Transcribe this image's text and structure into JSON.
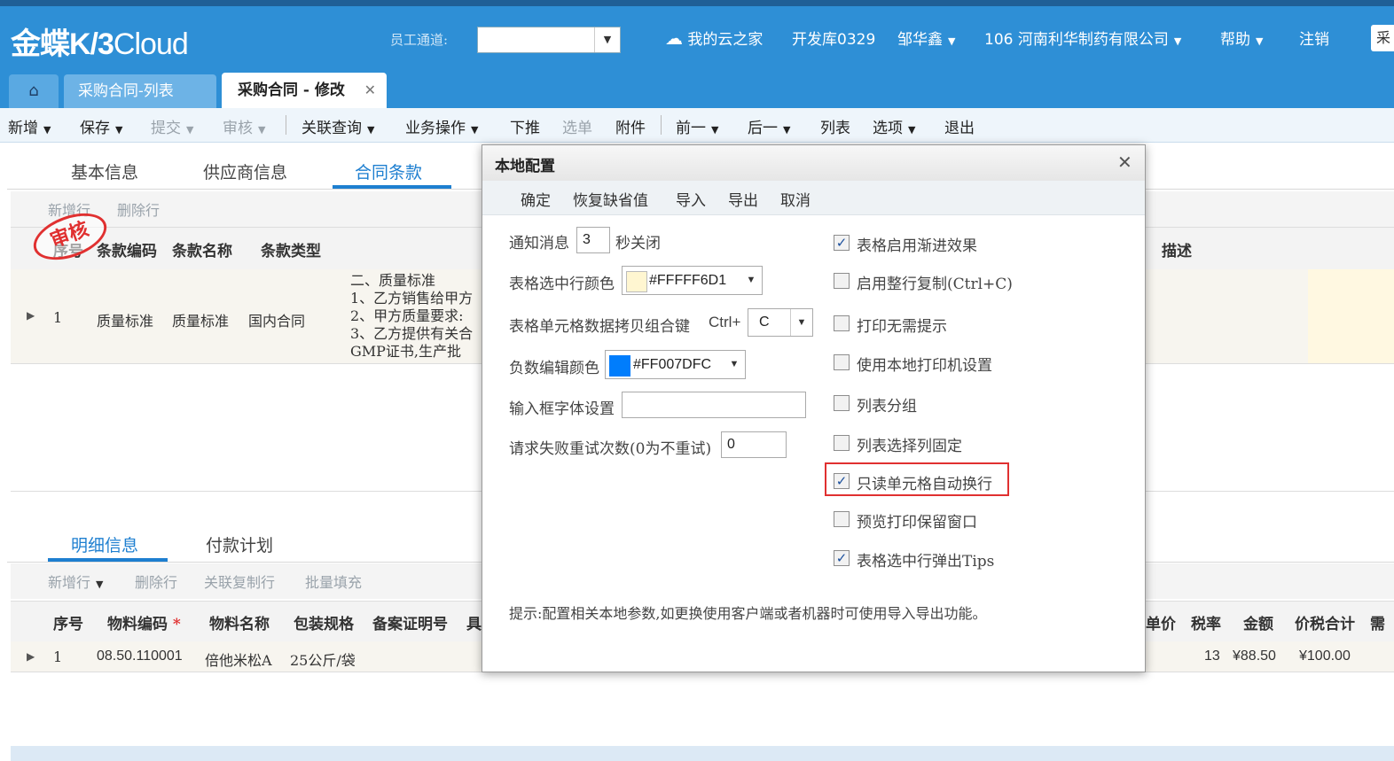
{
  "header": {
    "logo_main": "金蝶",
    "logo_k3": "K/3",
    "logo_cloud": "Cloud",
    "staff_channel_label": "员工通道:",
    "staff_channel_value": "",
    "cloud_home": "我的云之家",
    "dev_lib": "开发库0329",
    "user": "邹华鑫",
    "org": "106 河南利华制药有限公司",
    "help": "帮助",
    "logout": "注销",
    "search_prefix": "采"
  },
  "tabs": [
    {
      "label": "采购合同-列表"
    },
    {
      "label": "采购合同 - 修改"
    }
  ],
  "toolbar": [
    {
      "label": "新增",
      "dropdown": true,
      "enabled": true
    },
    {
      "label": "保存",
      "dropdown": true,
      "enabled": true
    },
    {
      "label": "提交",
      "dropdown": true,
      "enabled": false
    },
    {
      "label": "审核",
      "dropdown": true,
      "enabled": false
    },
    {
      "label": "关联查询",
      "dropdown": true,
      "enabled": true
    },
    {
      "label": "业务操作",
      "dropdown": true,
      "enabled": true
    },
    {
      "label": "下推",
      "dropdown": false,
      "enabled": true
    },
    {
      "label": "选单",
      "dropdown": false,
      "enabled": false
    },
    {
      "label": "附件",
      "dropdown": false,
      "enabled": true
    },
    {
      "label": "前一",
      "dropdown": true,
      "enabled": true
    },
    {
      "label": "后一",
      "dropdown": true,
      "enabled": true
    },
    {
      "label": "列表",
      "dropdown": false,
      "enabled": true
    },
    {
      "label": "选项",
      "dropdown": true,
      "enabled": true
    },
    {
      "label": "退出",
      "dropdown": false,
      "enabled": true
    }
  ],
  "section_tabs": [
    "基本信息",
    "供应商信息",
    "合同条款"
  ],
  "clause_toolbar": {
    "add_row": "新增行",
    "delete_row": "删除行"
  },
  "stamp": "审核",
  "clause_grid": {
    "headers": [
      "序号",
      "条款编码",
      "条款名称",
      "条款类型",
      "描述"
    ],
    "row": {
      "seq": "1",
      "code": "质量标准",
      "name": "质量标准",
      "type": "国内合同",
      "content_lines": [
        "二、质量标准",
        "1、乙方销售给甲方",
        "2、甲方质量要求:",
        "3、乙方提供有关合",
        "GMP证书,生产批"
      ]
    }
  },
  "detail_tabs": [
    "明细信息",
    "付款计划"
  ],
  "detail_toolbar": {
    "add_row": "新增行",
    "delete_row": "删除行",
    "copy_row": "关联复制行",
    "batch_fill": "批量填充"
  },
  "detail_grid": {
    "headers": [
      "序号",
      "物料编码",
      "物料名称",
      "包装规格",
      "备案证明号",
      "具",
      "单价",
      "税率",
      "金额",
      "价税合计",
      "需"
    ],
    "row": {
      "seq": "1",
      "code": "08.50.110001",
      "name": "倍他米松A",
      "pack": "25公斤/袋",
      "tax_rate": "13",
      "amount": "¥88.50",
      "total": "¥100.00"
    }
  },
  "dialog": {
    "title": "本地配置",
    "buttons": [
      "确定",
      "恢复缺省值",
      "导入",
      "导出",
      "取消"
    ],
    "notify_label": "通知消息",
    "notify_value": "3",
    "notify_suffix": "秒关闭",
    "row_color_label": "表格选中行颜色",
    "row_color_value": "#FFFFF6D1",
    "row_color_swatch": "#FFF6D1",
    "copy_key_label": "表格单元格数据拷贝组合键",
    "copy_key_prefix": "Ctrl+",
    "copy_key_value": "C",
    "neg_color_label": "负数编辑颜色",
    "neg_color_value": "#FF007DFC",
    "neg_color_swatch": "#007DFC",
    "font_label": "输入框字体设置",
    "font_value": "",
    "retry_label": "请求失败重试次数(0为不重试)",
    "retry_value": "0",
    "checkboxes": [
      {
        "label": "表格启用渐进效果",
        "checked": true
      },
      {
        "label": "启用整行复制(Ctrl+C)",
        "checked": false
      },
      {
        "label": "打印无需提示",
        "checked": false
      },
      {
        "label": "使用本地打印机设置",
        "checked": false
      },
      {
        "label": "列表分组",
        "checked": false
      },
      {
        "label": "列表选择列固定",
        "checked": false
      },
      {
        "label": "只读单元格自动换行",
        "checked": true
      },
      {
        "label": "预览打印保留窗口",
        "checked": false
      },
      {
        "label": "表格选中行弹出Tips",
        "checked": true
      }
    ],
    "hint": "提示:配置相关本地参数,如更换使用客户端或者机器时可使用导入导出功能。"
  },
  "colors": {
    "header": "#2e8fd6",
    "accent": "#1e7fd0",
    "highlight_border": "#e03030"
  }
}
